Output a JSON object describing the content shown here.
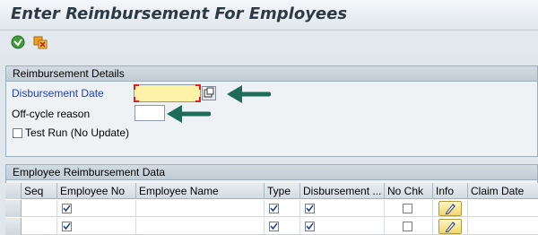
{
  "window": {
    "title": "Enter Reimbursement For Employees"
  },
  "toolbar": {
    "execute_icon": "execute-icon",
    "variant_icon": "get-variant-icon"
  },
  "reimbursement_details": {
    "header": "Reimbursement Details",
    "disbursement_date_label": "Disbursement Date",
    "disbursement_date_value": "",
    "off_cycle_label": "Off-cycle reason",
    "off_cycle_value": "",
    "test_run_label": "Test Run (No Update)",
    "test_run_checked": false
  },
  "employee_data": {
    "header": "Employee Reimbursement Data",
    "columns": [
      "Seq",
      "Employee No",
      "Employee Name",
      "Type",
      "Disbursement ...",
      "No Chk",
      "Info",
      "Claim Date"
    ],
    "rows": [
      {
        "seq": "",
        "employee_no_checked": true,
        "employee_name": "",
        "type_checked": true,
        "disbursement_checked": true,
        "no_chk_checked": false,
        "info_icon": "edit-icon",
        "claim_date": ""
      },
      {
        "seq": "",
        "employee_no_checked": true,
        "employee_name": "",
        "type_checked": true,
        "disbursement_checked": true,
        "no_chk_checked": false,
        "info_icon": "edit-icon",
        "claim_date": ""
      }
    ]
  },
  "colors": {
    "required_label": "#1f3fb8",
    "required_field_bg": "#fdf2a8",
    "arrow": "#1f6b5a",
    "background": "#dfe6ec"
  }
}
